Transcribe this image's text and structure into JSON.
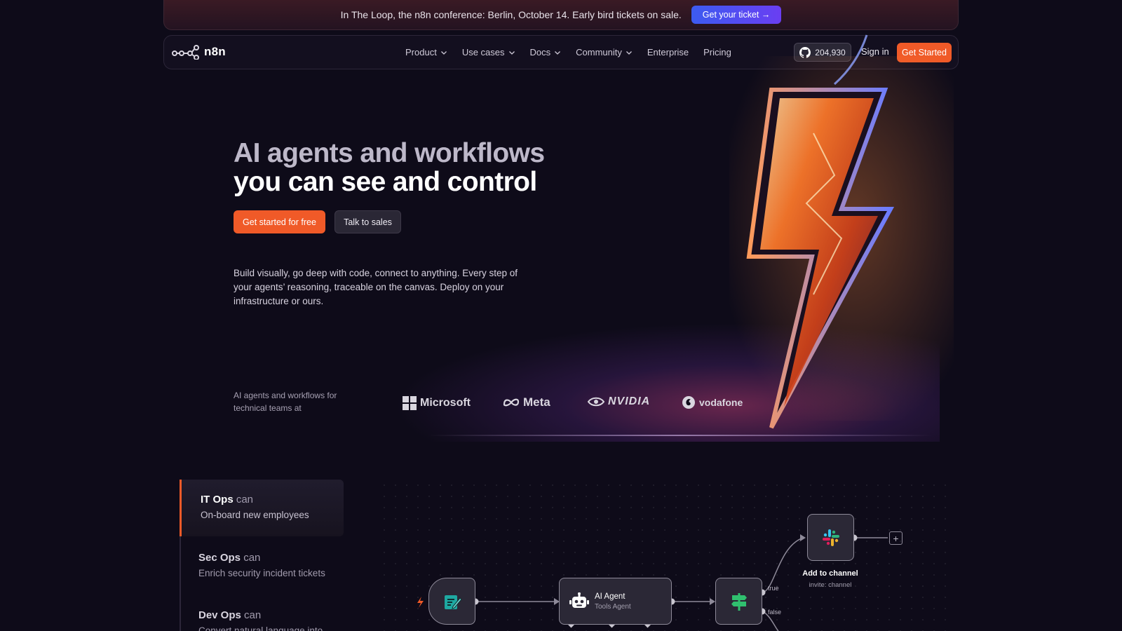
{
  "banner": {
    "text": "In The Loop, the n8n conference: Berlin, October 14. Early bird tickets on sale.",
    "cta": "Get your ticket →"
  },
  "nav": {
    "logo_text": "n8n",
    "links": [
      {
        "label": "Product",
        "has_menu": true
      },
      {
        "label": "Use cases",
        "has_menu": true
      },
      {
        "label": "Docs",
        "has_menu": true
      },
      {
        "label": "Community",
        "has_menu": true
      },
      {
        "label": "Enterprise",
        "has_menu": false
      },
      {
        "label": "Pricing",
        "has_menu": false
      }
    ],
    "github_stars": "204,930",
    "sign_in": "Sign in",
    "cta": "Get Started"
  },
  "hero": {
    "headline_line1": "AI agents and workflows",
    "headline_line2": "you can see and control",
    "primary_cta": "Get started for free",
    "secondary_cta": "Talk to sales",
    "description": "Build visually, go deep with code, connect to anything. Every step of your agents’ reasoning, traceable on the canvas. Deploy on your infrastructure or ours.",
    "trust_label": "AI agents and workflows for technical teams at",
    "brands": [
      "Microsoft",
      "Meta",
      "NVIDIA",
      "vodafone"
    ]
  },
  "use_cases": [
    {
      "team": "IT Ops",
      "connector": "can",
      "task": "On-board new employees",
      "active": true
    },
    {
      "team": "Sec Ops",
      "connector": "can",
      "task": "Enrich security incident tickets",
      "active": false
    },
    {
      "team": "Dev Ops",
      "connector": "can",
      "task": "Convert natural language into",
      "active": false
    }
  ],
  "workflow": {
    "ai_agent_title": "AI Agent",
    "ai_agent_subtitle": "Tools Agent",
    "branch_true": "true",
    "branch_false": "false",
    "slack_title": "Add to channel",
    "slack_subtitle": "invite: channel",
    "add_symbol": "+"
  },
  "colors": {
    "background": "#0e0b19",
    "accent": "#f05a28",
    "banner_button": "#3c5bf0",
    "node_fill": "#2b2836"
  }
}
